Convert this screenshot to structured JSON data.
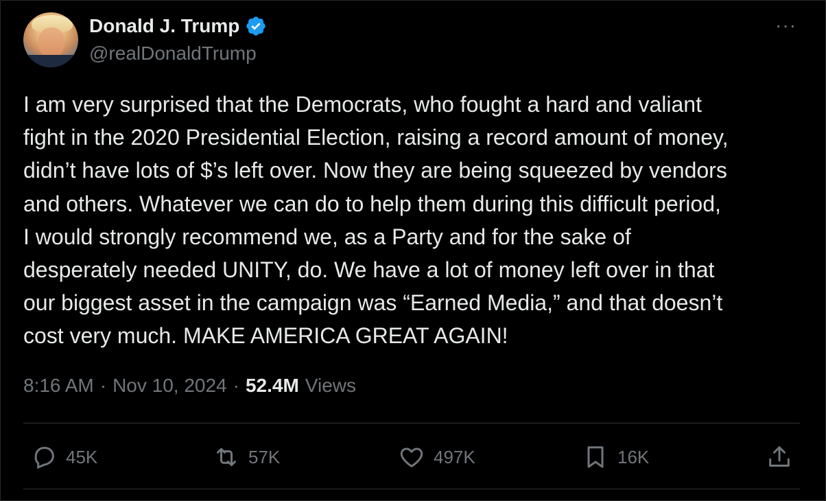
{
  "author": {
    "name": "Donald J. Trump",
    "handle": "@realDonaldTrump",
    "verified": true,
    "verified_color": "#1d9bf0"
  },
  "tweet": {
    "lines": [
      "I am very surprised that the Democrats, who fought a hard and valiant",
      "fight in the 2020 Presidential Election, raising a record amount of money,",
      "didn’t have lots of $’s left over. Now they are being squeezed by vendors",
      "and others. Whatever we can do to help them during this difficult period,",
      "I would strongly recommend we, as a Party and for the sake of",
      "desperately needed UNITY, do. We have a lot of money left over in that",
      "our biggest asset in the campaign was “Earned Media,” and that doesn’t",
      "cost very much. MAKE AMERICA GREAT AGAIN!"
    ]
  },
  "meta": {
    "time": "8:16 AM",
    "separator": "·",
    "date": "Nov 10, 2024",
    "views_count": "52.4M",
    "views_label": "Views"
  },
  "actions": {
    "replies": "45K",
    "reposts": "57K",
    "likes": "497K",
    "bookmarks": "16K"
  },
  "icons": {
    "more": "more-options-icon",
    "reply": "reply-icon",
    "repost": "repost-icon",
    "like": "heart-icon",
    "bookmark": "bookmark-icon",
    "share": "share-icon"
  },
  "colors": {
    "background": "#000000",
    "text": "#e7e9ea",
    "secondary": "#71767b",
    "divider": "#2f3336"
  }
}
